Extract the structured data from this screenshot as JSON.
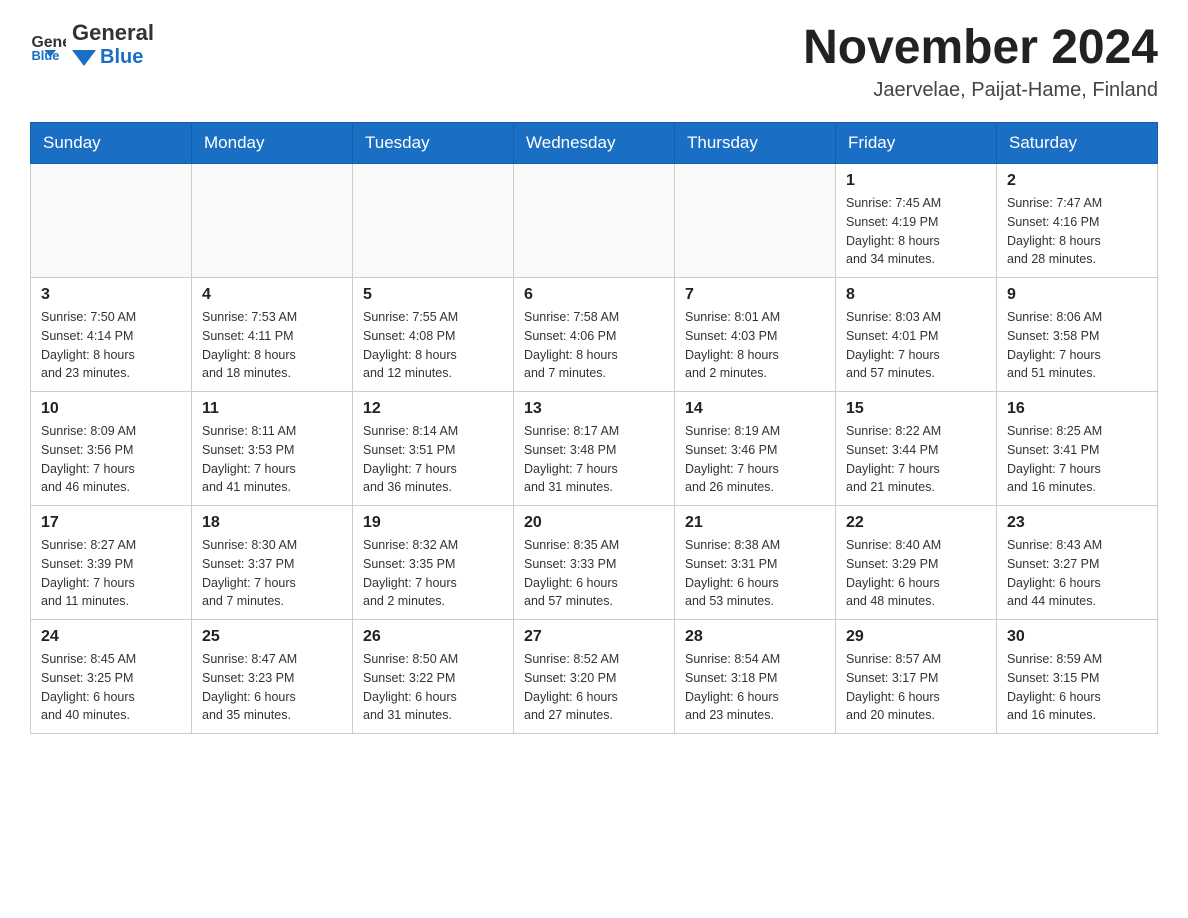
{
  "header": {
    "logo_text_black": "General",
    "logo_text_blue": "Blue",
    "month_year": "November 2024",
    "location": "Jaervelae, Paijat-Hame, Finland"
  },
  "days_of_week": [
    "Sunday",
    "Monday",
    "Tuesday",
    "Wednesday",
    "Thursday",
    "Friday",
    "Saturday"
  ],
  "weeks": [
    [
      {
        "day": "",
        "info": ""
      },
      {
        "day": "",
        "info": ""
      },
      {
        "day": "",
        "info": ""
      },
      {
        "day": "",
        "info": ""
      },
      {
        "day": "",
        "info": ""
      },
      {
        "day": "1",
        "info": "Sunrise: 7:45 AM\nSunset: 4:19 PM\nDaylight: 8 hours\nand 34 minutes."
      },
      {
        "day": "2",
        "info": "Sunrise: 7:47 AM\nSunset: 4:16 PM\nDaylight: 8 hours\nand 28 minutes."
      }
    ],
    [
      {
        "day": "3",
        "info": "Sunrise: 7:50 AM\nSunset: 4:14 PM\nDaylight: 8 hours\nand 23 minutes."
      },
      {
        "day": "4",
        "info": "Sunrise: 7:53 AM\nSunset: 4:11 PM\nDaylight: 8 hours\nand 18 minutes."
      },
      {
        "day": "5",
        "info": "Sunrise: 7:55 AM\nSunset: 4:08 PM\nDaylight: 8 hours\nand 12 minutes."
      },
      {
        "day": "6",
        "info": "Sunrise: 7:58 AM\nSunset: 4:06 PM\nDaylight: 8 hours\nand 7 minutes."
      },
      {
        "day": "7",
        "info": "Sunrise: 8:01 AM\nSunset: 4:03 PM\nDaylight: 8 hours\nand 2 minutes."
      },
      {
        "day": "8",
        "info": "Sunrise: 8:03 AM\nSunset: 4:01 PM\nDaylight: 7 hours\nand 57 minutes."
      },
      {
        "day": "9",
        "info": "Sunrise: 8:06 AM\nSunset: 3:58 PM\nDaylight: 7 hours\nand 51 minutes."
      }
    ],
    [
      {
        "day": "10",
        "info": "Sunrise: 8:09 AM\nSunset: 3:56 PM\nDaylight: 7 hours\nand 46 minutes."
      },
      {
        "day": "11",
        "info": "Sunrise: 8:11 AM\nSunset: 3:53 PM\nDaylight: 7 hours\nand 41 minutes."
      },
      {
        "day": "12",
        "info": "Sunrise: 8:14 AM\nSunset: 3:51 PM\nDaylight: 7 hours\nand 36 minutes."
      },
      {
        "day": "13",
        "info": "Sunrise: 8:17 AM\nSunset: 3:48 PM\nDaylight: 7 hours\nand 31 minutes."
      },
      {
        "day": "14",
        "info": "Sunrise: 8:19 AM\nSunset: 3:46 PM\nDaylight: 7 hours\nand 26 minutes."
      },
      {
        "day": "15",
        "info": "Sunrise: 8:22 AM\nSunset: 3:44 PM\nDaylight: 7 hours\nand 21 minutes."
      },
      {
        "day": "16",
        "info": "Sunrise: 8:25 AM\nSunset: 3:41 PM\nDaylight: 7 hours\nand 16 minutes."
      }
    ],
    [
      {
        "day": "17",
        "info": "Sunrise: 8:27 AM\nSunset: 3:39 PM\nDaylight: 7 hours\nand 11 minutes."
      },
      {
        "day": "18",
        "info": "Sunrise: 8:30 AM\nSunset: 3:37 PM\nDaylight: 7 hours\nand 7 minutes."
      },
      {
        "day": "19",
        "info": "Sunrise: 8:32 AM\nSunset: 3:35 PM\nDaylight: 7 hours\nand 2 minutes."
      },
      {
        "day": "20",
        "info": "Sunrise: 8:35 AM\nSunset: 3:33 PM\nDaylight: 6 hours\nand 57 minutes."
      },
      {
        "day": "21",
        "info": "Sunrise: 8:38 AM\nSunset: 3:31 PM\nDaylight: 6 hours\nand 53 minutes."
      },
      {
        "day": "22",
        "info": "Sunrise: 8:40 AM\nSunset: 3:29 PM\nDaylight: 6 hours\nand 48 minutes."
      },
      {
        "day": "23",
        "info": "Sunrise: 8:43 AM\nSunset: 3:27 PM\nDaylight: 6 hours\nand 44 minutes."
      }
    ],
    [
      {
        "day": "24",
        "info": "Sunrise: 8:45 AM\nSunset: 3:25 PM\nDaylight: 6 hours\nand 40 minutes."
      },
      {
        "day": "25",
        "info": "Sunrise: 8:47 AM\nSunset: 3:23 PM\nDaylight: 6 hours\nand 35 minutes."
      },
      {
        "day": "26",
        "info": "Sunrise: 8:50 AM\nSunset: 3:22 PM\nDaylight: 6 hours\nand 31 minutes."
      },
      {
        "day": "27",
        "info": "Sunrise: 8:52 AM\nSunset: 3:20 PM\nDaylight: 6 hours\nand 27 minutes."
      },
      {
        "day": "28",
        "info": "Sunrise: 8:54 AM\nSunset: 3:18 PM\nDaylight: 6 hours\nand 23 minutes."
      },
      {
        "day": "29",
        "info": "Sunrise: 8:57 AM\nSunset: 3:17 PM\nDaylight: 6 hours\nand 20 minutes."
      },
      {
        "day": "30",
        "info": "Sunrise: 8:59 AM\nSunset: 3:15 PM\nDaylight: 6 hours\nand 16 minutes."
      }
    ]
  ]
}
